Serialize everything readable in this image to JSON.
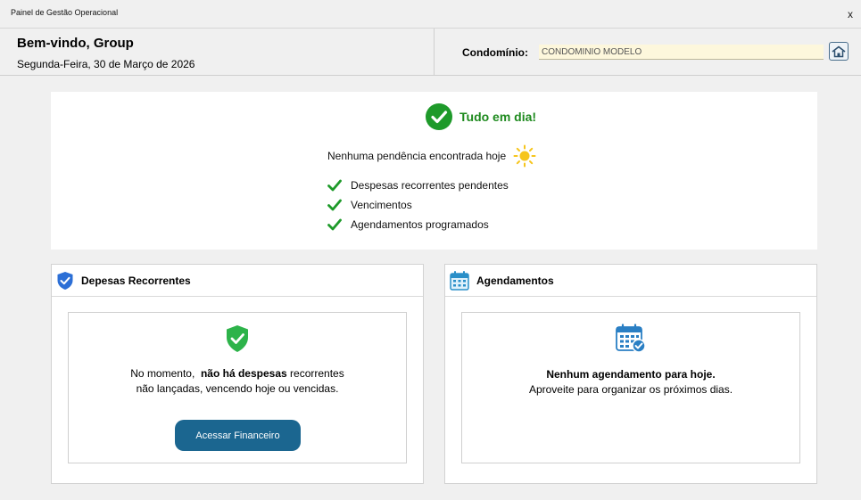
{
  "window": {
    "title": "Painel de Gestão Operacional",
    "close_label": "x"
  },
  "header": {
    "welcome": "Bem-vindo, Group",
    "date": "Segunda-Feira, 30 de Março de 2026",
    "condo_label": "Condomínio:",
    "condo_value": "CONDOMINIO MODELO"
  },
  "status": {
    "title": "Tudo em dia!",
    "subtitle": "Nenhuma pendência encontrada hoje",
    "items": [
      "Despesas recorrentes pendentes",
      "Vencimentos",
      "Agendamentos programados"
    ]
  },
  "despesas": {
    "title": "Depesas Recorrentes",
    "msg_prefix": "No momento,",
    "msg_bold": "não há despesas",
    "msg_suffix": "recorrentes",
    "msg_line2": "não lançadas, vencendo hoje ou vencidas.",
    "button": "Acessar Financeiro"
  },
  "agendamentos": {
    "title": "Agendamentos",
    "msg_bold": "Nenhum agendamento para hoje.",
    "msg_line2": "Aproveite para organizar os próximos dias."
  },
  "colors": {
    "accent_green": "#1e8a1e",
    "button_blue": "#1b6690",
    "input_bg": "#fdf7dc"
  }
}
